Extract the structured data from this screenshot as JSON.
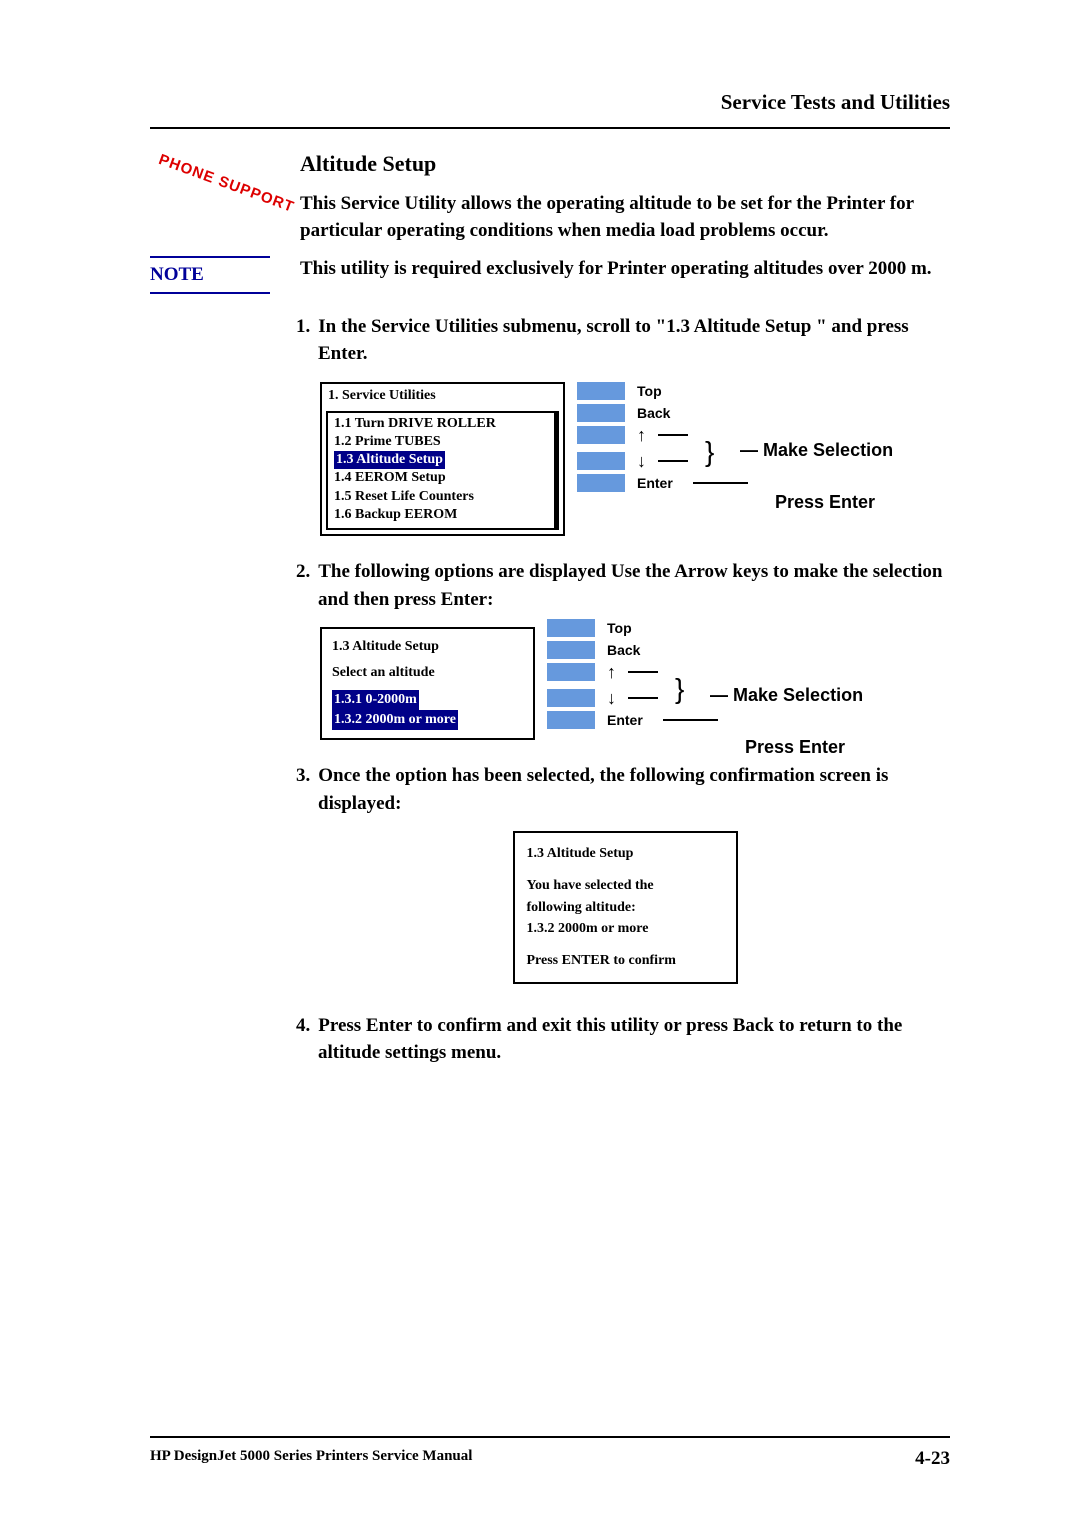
{
  "header": {
    "section_title": "Service Tests and Utilities"
  },
  "badge": {
    "phone_support": "PHONE SUPPORT"
  },
  "section": {
    "title": "Altitude Setup",
    "intro": "This Service Utility allows the operating altitude to be set for the Printer for particular operating conditions when media load problems occur."
  },
  "note": {
    "label": "NOTE",
    "text": "This utility is required exclusively for Printer operating altitudes over 2000 m."
  },
  "steps": {
    "s1_num": "1.",
    "s1_text_a": "In the Service Utilities submenu, scroll to \"1.3 Altitude Setup \" and press ",
    "s1_text_b": "Enter.",
    "s2_num": "2.",
    "s2_text_a": "The following options are displayed Use the Arrow keys to make the selection and then press ",
    "s2_text_b": "Enter:",
    "s3_num": "3.",
    "s3_text": "Once the option has been selected, the following confirmation screen is displayed:",
    "s4_num": "4.",
    "s4_text_a": "Press ",
    "s4_text_b": "Enter",
    "s4_text_c": " to confirm and exit this utility or press ",
    "s4_text_d": "Back",
    "s4_text_e": " to return to the altitude settings menu."
  },
  "lcd1": {
    "title": "1. Service Utilities",
    "l1": "1.1 Turn DRIVE ROLLER",
    "l2": "1.2 Prime TUBES",
    "l3": "1.3 Altitude Setup",
    "l4": "1.4 EEROM Setup",
    "l5": "1.5 Reset Life Counters",
    "l6": "1.6 Backup EEROM"
  },
  "lcd2": {
    "title": "1.3 Altitude Setup",
    "prompt": "Select an altitude",
    "opt1": "1.3.1 0-2000m",
    "opt2": "1.3.2 2000m or more"
  },
  "lcd3": {
    "title": "1.3 Altitude Setup",
    "l1": "You have selected the",
    "l2": "following altitude:",
    "l3": "1.3.2 2000m or more",
    "l4": "Press ENTER to confirm"
  },
  "buttons": {
    "top": "Top",
    "back": "Back",
    "up": "↑",
    "down": "↓",
    "enter": "Enter"
  },
  "annotations": {
    "make_selection": "Make Selection",
    "press_enter": "Press Enter"
  },
  "footer": {
    "manual": "HP DesignJet 5000 Series Printers Service Manual",
    "page": "4-23"
  }
}
